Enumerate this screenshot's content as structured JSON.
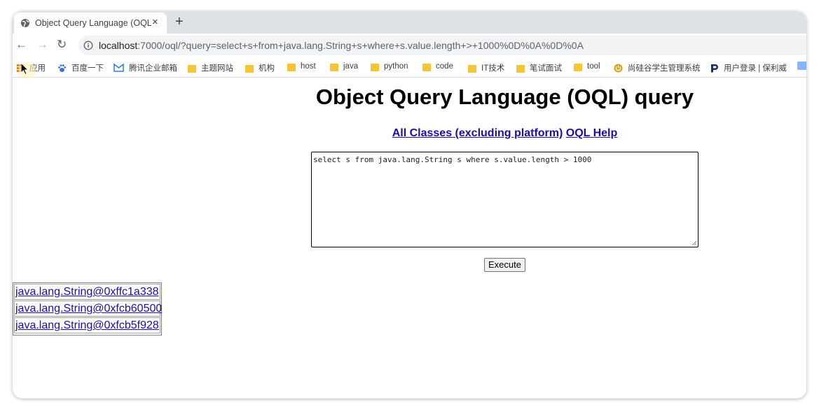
{
  "browser": {
    "tab_title": "Object Query Language (OQL) query",
    "tab_close": "×",
    "new_tab": "+",
    "nav": {
      "back": "←",
      "forward": "→",
      "reload": "↻"
    },
    "url_host": "localhost",
    "url_rest": ":7000/oql/?query=select+s+from+java.lang.String+s+where+s.value.length+>+1000%0D%0A%0D%0A"
  },
  "bookmarks": [
    {
      "label": "应用",
      "icon": "apps-icon"
    },
    {
      "label": "百度一下",
      "icon": "baidu-icon"
    },
    {
      "label": "腾讯企业邮箱",
      "icon": "tencent-mail-icon"
    },
    {
      "label": "主题网站",
      "icon": "folder-icon"
    },
    {
      "label": "机构",
      "icon": "folder-icon"
    },
    {
      "label": "host",
      "icon": "folder-icon"
    },
    {
      "label": "java",
      "icon": "folder-icon"
    },
    {
      "label": "python",
      "icon": "folder-icon"
    },
    {
      "label": "code",
      "icon": "folder-icon"
    },
    {
      "label": "IT技术",
      "icon": "folder-icon"
    },
    {
      "label": "笔试面试",
      "icon": "folder-icon"
    },
    {
      "label": "tool",
      "icon": "folder-icon"
    },
    {
      "label": "尚硅谷学生管理系统",
      "icon": "power-icon"
    },
    {
      "label": "用户登录 | 保利威",
      "icon": "polyv-icon"
    }
  ],
  "page": {
    "title": "Object Query Language (OQL) query",
    "link_all_classes": "All Classes (excluding platform)",
    "link_oql_help": "OQL Help",
    "query_text": "select s from java.lang.String s where s.value.length > 1000\n\n",
    "execute_label": "Execute",
    "results": [
      "java.lang.String@0xffc1a338",
      "java.lang.String@0xfcb60500",
      "java.lang.String@0xfcb5f928"
    ]
  },
  "colors": {
    "link": "#1a0dab",
    "folder": "#f5c534",
    "tabstrip": "#dee1e6",
    "omnibox": "#f1f3f4"
  }
}
